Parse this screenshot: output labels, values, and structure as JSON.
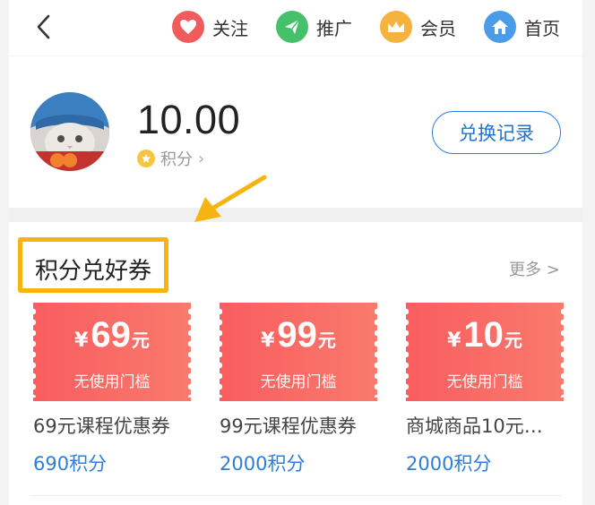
{
  "nav": {
    "items": [
      {
        "label": "关注",
        "icon": "heart-icon",
        "color": "#f25b5b"
      },
      {
        "label": "推广",
        "icon": "paper-plane-icon",
        "color": "#46c06a"
      },
      {
        "label": "会员",
        "icon": "crown-icon",
        "color": "#f5b23c"
      },
      {
        "label": "首页",
        "icon": "home-icon",
        "color": "#4a9be8"
      }
    ]
  },
  "profile": {
    "balance": "10.00",
    "points_label": "积分",
    "redeem_history_label": "兑换记录"
  },
  "section": {
    "title": "积分兑好券",
    "more_label": "更多 >"
  },
  "coupons": [
    {
      "currency": "¥",
      "amount": "69",
      "unit": "元",
      "threshold": "无使用门槛",
      "name": "69元课程优惠券",
      "cost": "690积分"
    },
    {
      "currency": "¥",
      "amount": "99",
      "unit": "元",
      "threshold": "无使用门槛",
      "name": "99元课程优惠券",
      "cost": "2000积分"
    },
    {
      "currency": "¥",
      "amount": "10",
      "unit": "元",
      "threshold": "无使用门槛",
      "name": "商城商品10元…",
      "cost": "2000积分"
    }
  ],
  "colors": {
    "accent_blue": "#2b7fd9",
    "coupon_red": "#f95d5f",
    "highlight_yellow": "#f5b40f"
  }
}
